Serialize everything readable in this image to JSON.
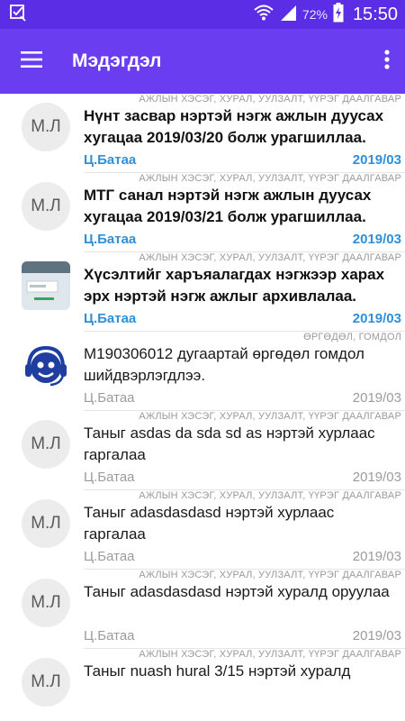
{
  "status_bar": {
    "battery_pct": "72%",
    "time": "15:50",
    "icons": [
      "checkbox-notification-icon",
      "wifi-icon",
      "signal-icon",
      "battery-charging-icon"
    ]
  },
  "app_bar": {
    "title": "Мэдэгдэл",
    "icons": [
      "menu-icon",
      "more-vert-icon"
    ]
  },
  "notifications": [
    {
      "category": "АЖЛЫН ХЭСЭГ, ХУРАЛ, УУЛЗАЛТ, ҮҮРЭГ ДААЛГАВАР",
      "avatar_text": "М.Л",
      "message": "Нүнт засвар нэртэй нэгж ажлын дуусах хугацаа 2019/03/20 болж урагшиллаа.",
      "sender": "Ц.Батаа",
      "date": "2019/03",
      "unread": true
    },
    {
      "category": "АЖЛЫН ХЭСЭГ, ХУРАЛ, УУЛЗАЛТ, ҮҮРЭГ ДААЛГАВАР",
      "avatar_text": "М.Л",
      "message": "МТГ санал нэртэй нэгж ажлын дуусах хугацаа 2019/03/21 болж урагшиллаа.",
      "sender": "Ц.Батаа",
      "date": "2019/03",
      "unread": true
    },
    {
      "category": "АЖЛЫН ХЭСЭГ, ХУРАЛ, УУЛЗАЛТ, ҮҮРЭГ ДААЛГАВАР",
      "avatar_icon": "archive-screen-icon",
      "message": "Хүсэлтийг харъяалагдах нэгжээр харах эрх нэртэй нэгж ажлыг архивлалаа.",
      "sender": "Ц.Батаа",
      "date": "2019/03",
      "unread": true
    },
    {
      "category": "ӨРГӨДӨЛ, ГОМДОЛ",
      "avatar_icon": "support-agent-icon",
      "message": "М190306012 дугаартай өргөдөл гомдол шийдвэрлэгдлээ.",
      "sender": "Ц.Батаа",
      "date": "2019/03",
      "unread": false
    },
    {
      "category": "АЖЛЫН ХЭСЭГ, ХУРАЛ, УУЛЗАЛТ, ҮҮРЭГ ДААЛГАВАР",
      "avatar_text": "М.Л",
      "message": "Таныг asdas da sda sd as нэртэй хурлаас гаргалаа",
      "sender": "Ц.Батаа",
      "date": "2019/03",
      "unread": false
    },
    {
      "category": "АЖЛЫН ХЭСЭГ, ХУРАЛ, УУЛЗАЛТ, ҮҮРЭГ ДААЛГАВАР",
      "avatar_text": "М.Л",
      "message": "Таныг adasdasdasd нэртэй хурлаас гаргалаа",
      "sender": "Ц.Батаа",
      "date": "2019/03",
      "unread": false
    },
    {
      "category": "АЖЛЫН ХЭСЭГ, ХУРАЛ, УУЛЗАЛТ, ҮҮРЭГ ДААЛГАВАР",
      "avatar_text": "М.Л",
      "message": "Таныг adasdasdasd нэртэй хуралд оруулаа",
      "sender": "Ц.Батаа",
      "date": "2019/03",
      "unread": false
    },
    {
      "category": "АЖЛЫН ХЭСЭГ, ХУРАЛ, УУЛЗАЛТ, ҮҮРЭГ ДААЛГАВАР",
      "avatar_text": "М.Л",
      "message": "Таныг nuash hural 3/15 нэртэй хуралд",
      "sender": "",
      "date": "",
      "unread": false
    }
  ],
  "colors": {
    "status_bar": "#5b2ee6",
    "app_bar": "#6a3df0",
    "unread_accent": "#2f8fd8"
  }
}
